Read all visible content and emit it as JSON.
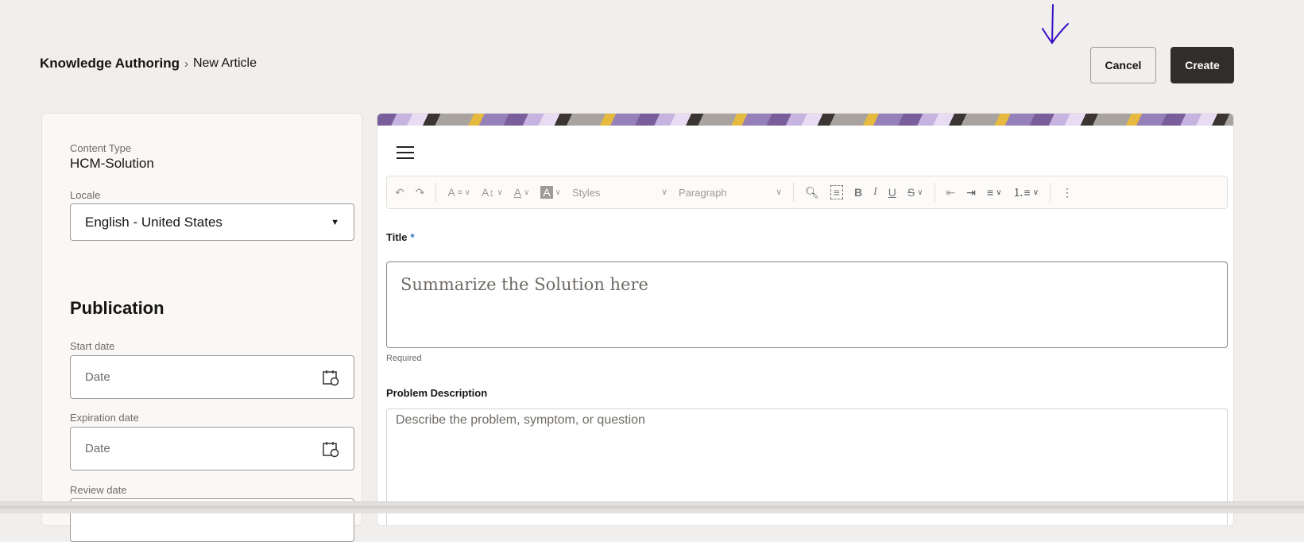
{
  "breadcrumb": {
    "root": "Knowledge Authoring",
    "separator": "›",
    "current": "New Article"
  },
  "actions": {
    "cancel": "Cancel",
    "create": "Create"
  },
  "left_panel": {
    "content_type_label": "Content Type",
    "content_type_value": "HCM-Solution",
    "locale_label": "Locale",
    "locale_value": "English - United States",
    "publication_heading": "Publication",
    "start_date_label": "Start date",
    "start_date_placeholder": "Date",
    "expiration_date_label": "Expiration date",
    "expiration_date_placeholder": "Date",
    "review_date_label": "Review date"
  },
  "toolbar": {
    "styles": "Styles",
    "paragraph": "Paragraph"
  },
  "form": {
    "title_label": "Title",
    "title_required_mark": "*",
    "title_placeholder": "Summarize the Solution here",
    "title_hint": "Required",
    "problem_label": "Problem Description",
    "problem_placeholder": "Describe the problem, symptom, or question"
  },
  "colors": {
    "annotation_arrow": "#3c0fc4",
    "primary_button": "#312d2a"
  }
}
